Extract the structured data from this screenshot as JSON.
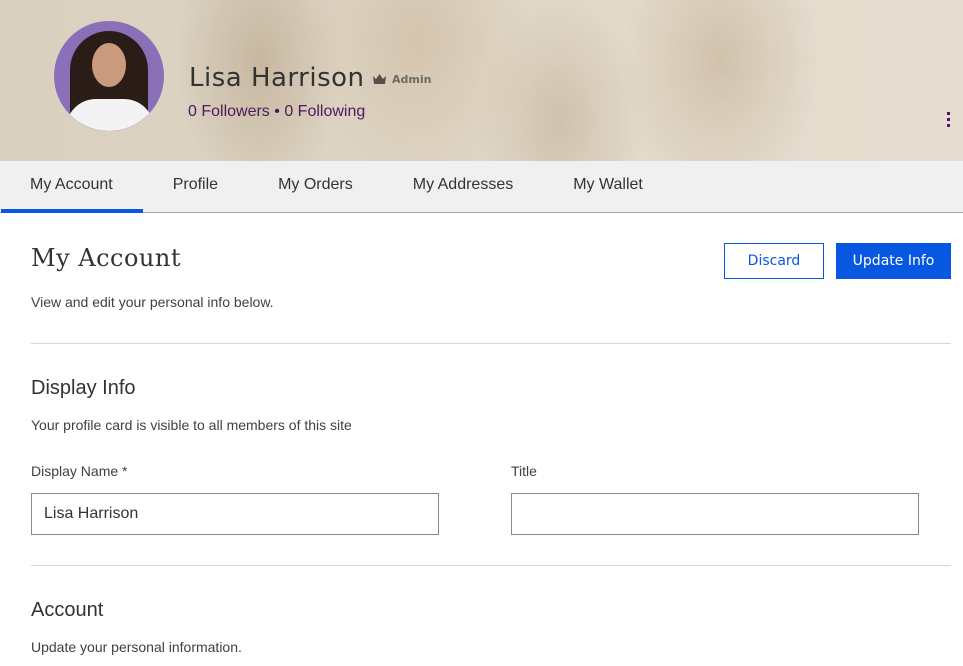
{
  "header": {
    "user_name": "Lisa Harrison",
    "role_icon": "crown-icon",
    "role_label": "Admin",
    "followers": "0 Followers",
    "separator": "•",
    "following": "0 Following",
    "more_icon": "more-vertical-icon",
    "accent_color": "#4b1a5e"
  },
  "tabs": [
    {
      "label": "My Account",
      "active": true
    },
    {
      "label": "Profile",
      "active": false
    },
    {
      "label": "My Orders",
      "active": false
    },
    {
      "label": "My Addresses",
      "active": false
    },
    {
      "label": "My Wallet",
      "active": false
    }
  ],
  "page": {
    "title": "My Account",
    "subtitle": "View and edit your personal info below.",
    "discard_label": "Discard",
    "update_label": "Update Info",
    "primary_color": "#0757e0"
  },
  "display_info": {
    "title": "Display Info",
    "subtitle": "Your profile card is visible to all members of this site",
    "display_name_label": "Display Name *",
    "display_name_value": "Lisa Harrison",
    "title_label": "Title",
    "title_value": ""
  },
  "account": {
    "title": "Account",
    "subtitle": "Update your personal information."
  }
}
